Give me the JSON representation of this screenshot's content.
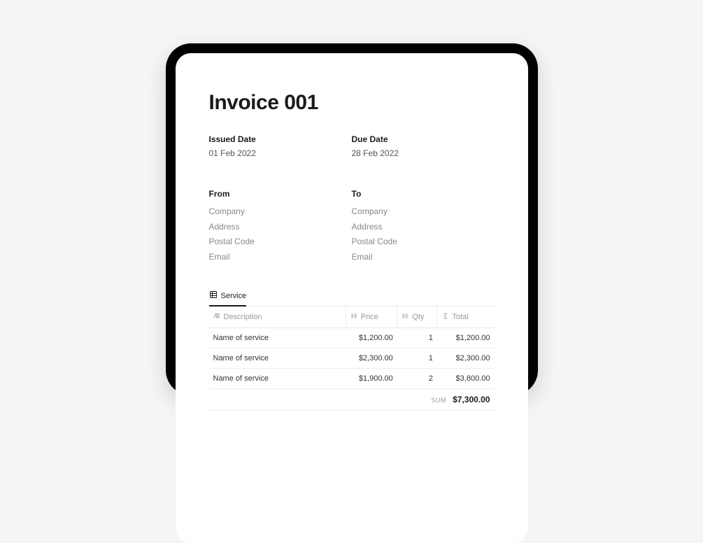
{
  "title": "Invoice 001",
  "issued": {
    "label": "Issued Date",
    "value": "01 Feb 2022"
  },
  "due": {
    "label": "Due Date",
    "value": "28 Feb 2022"
  },
  "from": {
    "label": "From",
    "company": "Company",
    "address": "Address",
    "postal": "Postal Code",
    "email": "Email"
  },
  "to": {
    "label": "To",
    "company": "Company",
    "address": "Address",
    "postal": "Postal Code",
    "email": "Email"
  },
  "table": {
    "tab": "Service",
    "headers": {
      "description": "Description",
      "price": "Price",
      "qty": "Qty",
      "total": "Total"
    },
    "rows": [
      {
        "description": "Name of service",
        "price": "$1,200.00",
        "qty": "1",
        "total": "$1,200.00"
      },
      {
        "description": "Name of service",
        "price": "$2,300.00",
        "qty": "1",
        "total": "$2,300.00"
      },
      {
        "description": "Name of service",
        "price": "$1,900.00",
        "qty": "2",
        "total": "$3,800.00"
      }
    ],
    "sum_label": "SUM",
    "sum_value": "$7,300.00"
  }
}
